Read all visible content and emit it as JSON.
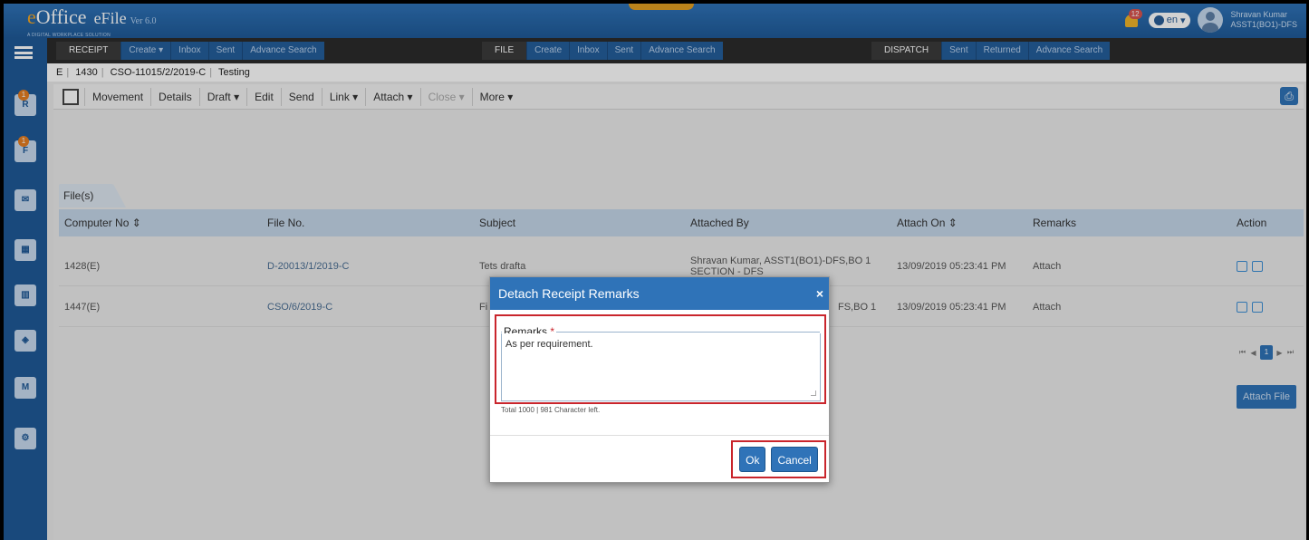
{
  "app": {
    "logo": "eOffice",
    "product": "eFile",
    "version": "Ver 6.0",
    "tagline": "A DIGITAL WORKPLACE SOLUTION"
  },
  "header": {
    "notifications": "12",
    "language": "en",
    "user_name": "Shravan Kumar",
    "user_role": "ASST1(BO1)-DFS"
  },
  "sidebar": {
    "badges": [
      "1",
      "1"
    ],
    "icons": [
      "receipt-icon",
      "file-icon",
      "dispatch-icon",
      "kms-icon",
      "dak-icon",
      "collab-icon",
      "meet-icon",
      "settings-icon"
    ]
  },
  "nav": {
    "receipt": {
      "title": "RECEIPT",
      "links": [
        "Create",
        "Inbox",
        "Sent",
        "Advance Search"
      ]
    },
    "file": {
      "title": "FILE",
      "links": [
        "Create",
        "Inbox",
        "Sent",
        "Advance Search"
      ]
    },
    "dispatch": {
      "title": "DISPATCH",
      "links": [
        "Sent",
        "Returned",
        "Advance Search"
      ]
    }
  },
  "breadcrumb": {
    "prefix": "E",
    "number": "1430",
    "file_no": "CSO-11015/2/2019-C",
    "subject": "Testing"
  },
  "toolbar": {
    "items": [
      "Movement",
      "Details",
      "Draft",
      "Edit",
      "Send",
      "Link",
      "Attach",
      "Close",
      "More"
    ]
  },
  "files_tab": "File(s)",
  "table": {
    "headers": [
      "Computer No",
      "File No.",
      "Subject",
      "Attached By",
      "Attach On",
      "Remarks",
      "Action"
    ],
    "rows": [
      {
        "computer_no": "1428(E)",
        "file_no": "D-20013/1/2019-C",
        "subject": "Tets drafta",
        "attached_by": "Shravan Kumar, ASST1(BO1)-DFS,BO 1 SECTION - DFS",
        "attach_on": "13/09/2019 05:23:41 PM",
        "remarks": "Attach"
      },
      {
        "computer_no": "1447(E)",
        "file_no": "CSO/6/2019-C",
        "subject": "Fi",
        "attached_by": "FS,BO 1",
        "attach_on": "13/09/2019 05:23:41 PM",
        "remarks": "Attach"
      }
    ]
  },
  "pager": {
    "current": "1"
  },
  "attach_file_button": "Attach File",
  "modal": {
    "title": "Detach Receipt Remarks",
    "close": "×",
    "remarks_label": "Remarks",
    "required_mark": "*",
    "remarks_value": "As per requirement.",
    "char_count": "Total 1000 | 981 Character left.",
    "ok": "Ok",
    "cancel": "Cancel"
  }
}
